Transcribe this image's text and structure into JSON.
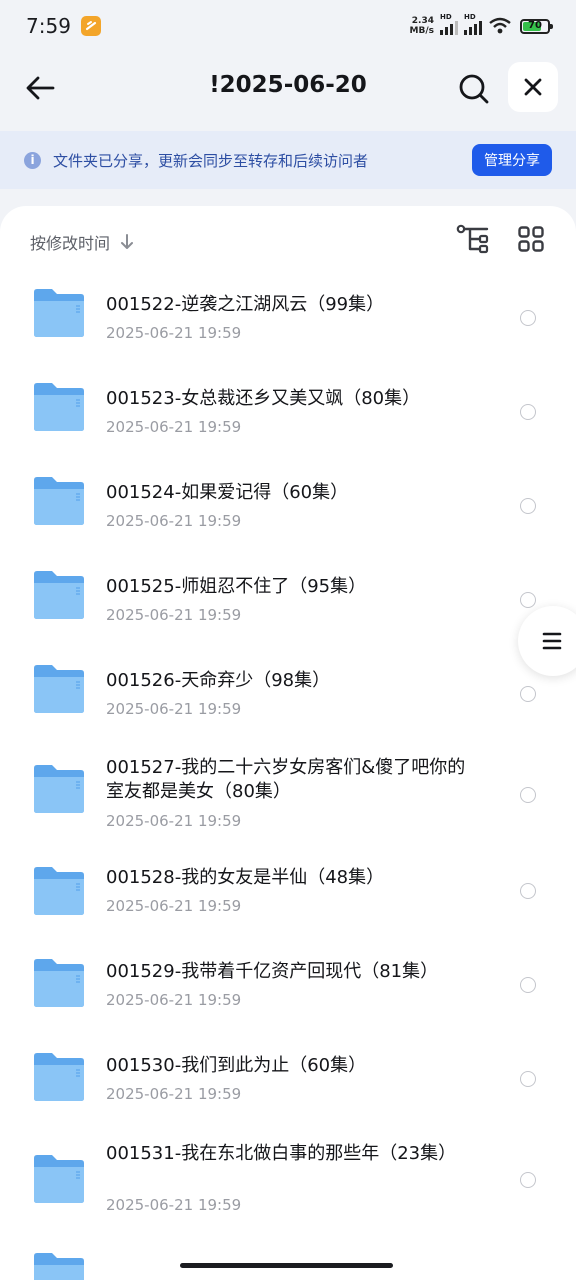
{
  "status_bar": {
    "time": "7:59",
    "net_speed_value": "2.34",
    "net_speed_unit": "MB/s",
    "hd_label": "HD",
    "battery": "70"
  },
  "header": {
    "title": "!2025-06-20"
  },
  "banner": {
    "text": "文件夹已分享，更新会同步至转存和后续访问者",
    "manage_button": "管理分享"
  },
  "sort": {
    "label": "按修改时间"
  },
  "files": [
    {
      "name": "001522-逆袭之江湖风云（99集）",
      "date": "2025-06-21 19:59"
    },
    {
      "name": "001523-女总裁还乡又美又飒（80集）",
      "date": "2025-06-21 19:59"
    },
    {
      "name": "001524-如果爱记得（60集）",
      "date": "2025-06-21 19:59"
    },
    {
      "name": "001525-师姐忍不住了（95集）",
      "date": "2025-06-21 19:59"
    },
    {
      "name": "001526-天命弃少（98集）",
      "date": "2025-06-21 19:59"
    },
    {
      "name": "001527-我的二十六岁女房客们&傻了吧你的室友都是美女（80集）",
      "date": "2025-06-21 19:59"
    },
    {
      "name": "001528-我的女友是半仙（48集）",
      "date": "2025-06-21 19:59"
    },
    {
      "name": "001529-我带着千亿资产回现代（81集）",
      "date": "2025-06-21 19:59"
    },
    {
      "name": "001530-我们到此为止（60集）",
      "date": "2025-06-21 19:59"
    },
    {
      "name": "001531-我在东北做白事的那些年（23集）",
      "date": "2025-06-21 19:59"
    }
  ],
  "colors": {
    "accent": "#1f5bea",
    "folder": "#6fb4f2"
  }
}
